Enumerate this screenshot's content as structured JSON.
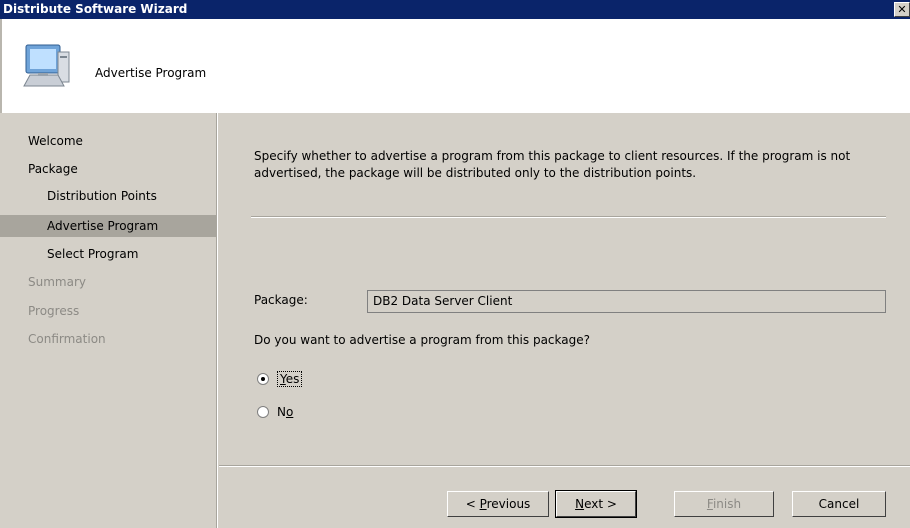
{
  "window": {
    "title": "Distribute Software Wizard",
    "close_glyph": "✕"
  },
  "header": {
    "title": "Advertise Program",
    "icon": "computer-icon"
  },
  "sidebar": {
    "items": [
      {
        "label": "Welcome",
        "state": "normal",
        "indent": 0
      },
      {
        "label": "Package",
        "state": "normal",
        "indent": 0
      },
      {
        "label": "Distribution Points",
        "state": "normal",
        "indent": 1
      },
      {
        "label": "Advertise Program",
        "state": "selected",
        "indent": 1
      },
      {
        "label": "Select Program",
        "state": "normal",
        "indent": 1
      },
      {
        "label": "Summary",
        "state": "disabled",
        "indent": 0
      },
      {
        "label": "Progress",
        "state": "disabled",
        "indent": 0
      },
      {
        "label": "Confirmation",
        "state": "disabled",
        "indent": 0
      }
    ]
  },
  "content": {
    "description": "Specify whether to advertise a program from this package to client resources.  If the program is not advertised, the package will be distributed only to the distribution points.",
    "package_label": "Package:",
    "package_value": "DB2 Data Server Client",
    "question": "Do you want to advertise a program from this package?",
    "options": [
      {
        "pre": "",
        "mnemonic": "Y",
        "post": "es",
        "selected": true
      },
      {
        "pre": "N",
        "mnemonic": "o",
        "post": "",
        "selected": false
      }
    ]
  },
  "buttons": {
    "previous": {
      "pre": "< ",
      "mnemonic": "P",
      "post": "revious"
    },
    "next": {
      "pre": "",
      "mnemonic": "N",
      "post": "ext >"
    },
    "finish": {
      "pre": "",
      "mnemonic": "F",
      "post": "inish"
    },
    "cancel": {
      "label": "Cancel"
    }
  }
}
